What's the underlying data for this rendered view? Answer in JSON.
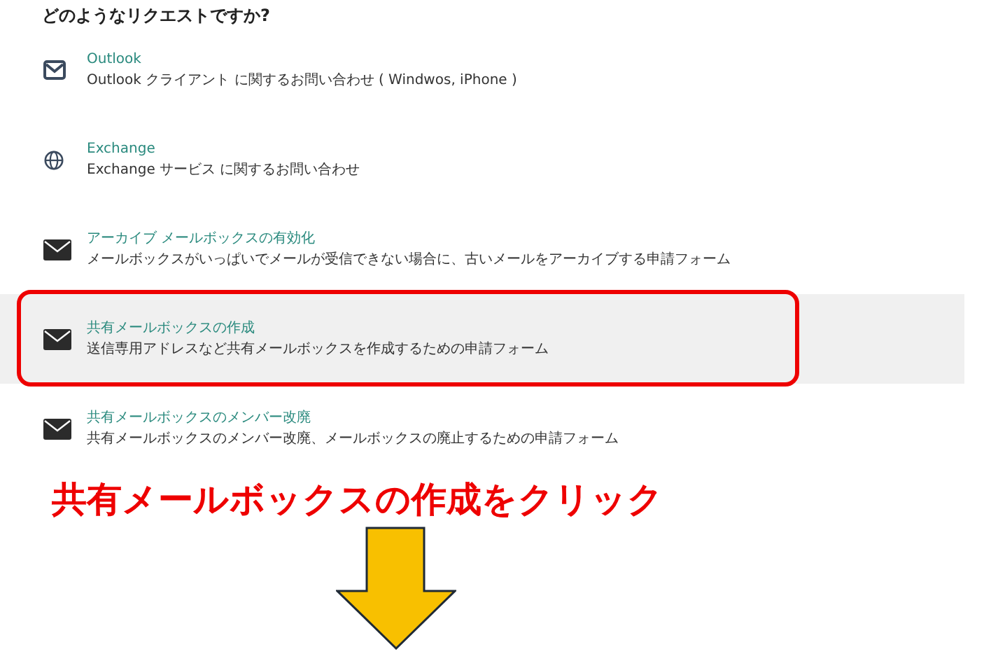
{
  "heading": "どのようなリクエストですか?",
  "items": [
    {
      "kind": "mail-outline",
      "title": "Outlook",
      "description": "Outlook クライアント に関するお問い合わせ ( Windwos, iPhone )",
      "selected": false,
      "highlighted": false
    },
    {
      "kind": "globe",
      "title": "Exchange",
      "description": "Exchange サービス に関するお問い合わせ",
      "selected": false,
      "highlighted": false
    },
    {
      "kind": "mail",
      "title": "アーカイブ メールボックスの有効化",
      "description": "メールボックスがいっぱいでメールが受信できない場合に、古いメールをアーカイブする申請フォーム",
      "selected": false,
      "highlighted": false
    },
    {
      "kind": "mail",
      "title": "共有メールボックスの作成",
      "description": "送信専用アドレスなど共有メールボックスを作成するための申請フォーム",
      "selected": true,
      "highlighted": true
    },
    {
      "kind": "mail",
      "title": "共有メールボックスのメンバー改廃",
      "description": "共有メールボックスのメンバー改廃、メールボックスの廃止するための申請フォーム",
      "selected": false,
      "highlighted": false
    }
  ],
  "annotation": "共有メールボックスの作成をクリック"
}
